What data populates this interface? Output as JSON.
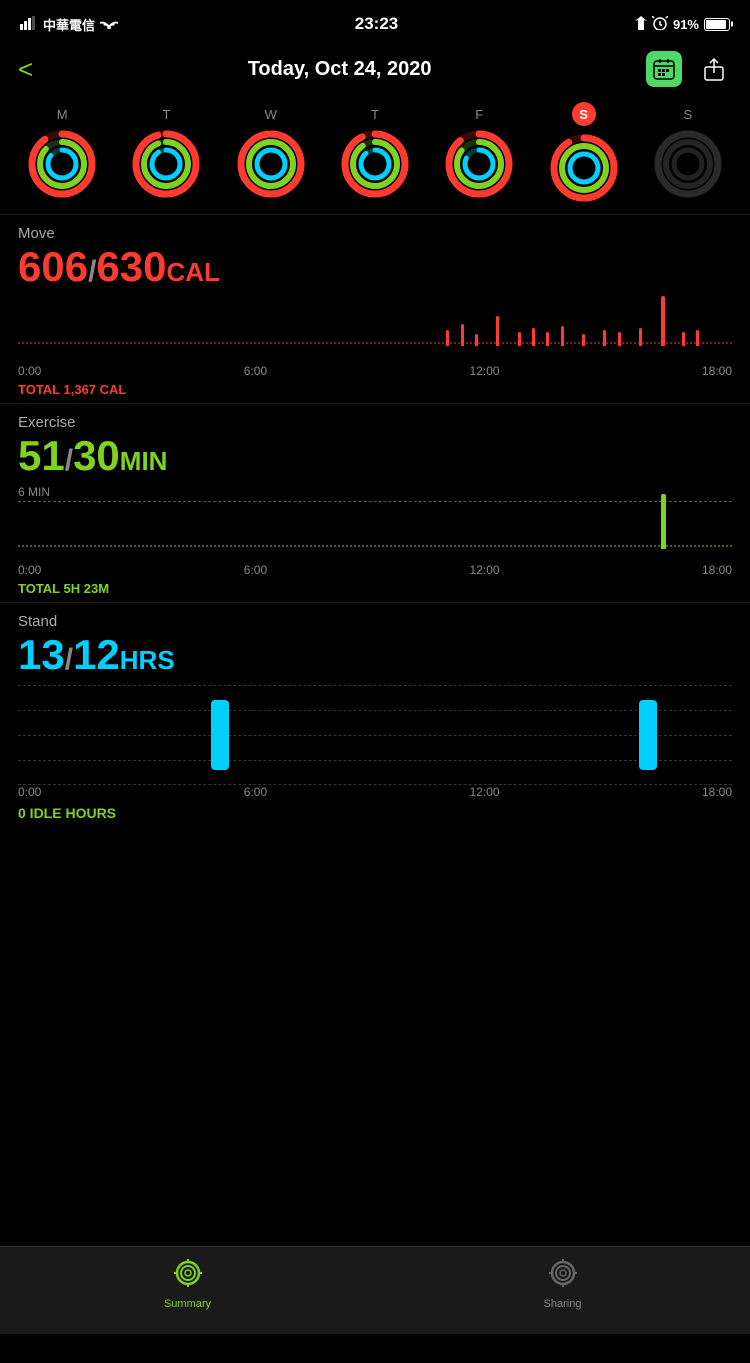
{
  "status": {
    "carrier": "中華電信",
    "time": "23:23",
    "battery": "91%"
  },
  "header": {
    "back_label": "<",
    "title": "Today, Oct 24, 2020",
    "calendar_icon": "calendar-icon",
    "share_icon": "share-icon"
  },
  "week": {
    "days": [
      "M",
      "T",
      "W",
      "T",
      "F",
      "S",
      "S"
    ],
    "today_index": 5,
    "today_letter": "S"
  },
  "move": {
    "label": "Move",
    "value": "606",
    "goal": "630",
    "unit": "CAL",
    "total_label": "TOTAL 1,367 CAL",
    "time_labels": [
      "0:00",
      "6:00",
      "12:00",
      "18:00"
    ]
  },
  "exercise": {
    "label": "Exercise",
    "value": "51",
    "goal": "30",
    "unit": "MIN",
    "total_label": "TOTAL 5H 23M",
    "guide": "6 MIN",
    "time_labels": [
      "0:00",
      "6:00",
      "12:00",
      "18:00"
    ]
  },
  "stand": {
    "label": "Stand",
    "value": "13",
    "goal": "12",
    "unit": "HRS",
    "idle_label": "0 IDLE HOURS",
    "time_labels": [
      "0:00",
      "6:00",
      "12:00",
      "18:00"
    ]
  },
  "tabs": {
    "summary_label": "Summary",
    "sharing_label": "Sharing"
  }
}
